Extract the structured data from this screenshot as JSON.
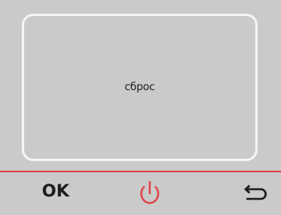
{
  "panel": {
    "message": "сброс"
  },
  "softkeys": {
    "ok_label": "OK",
    "power_icon": "power-icon",
    "back_icon": "back-arrow-icon"
  },
  "colors": {
    "background": "#cacaca",
    "panel_border": "#f4f4f4",
    "accent_red": "#e0444a",
    "text_dark": "#1e1e1e"
  }
}
